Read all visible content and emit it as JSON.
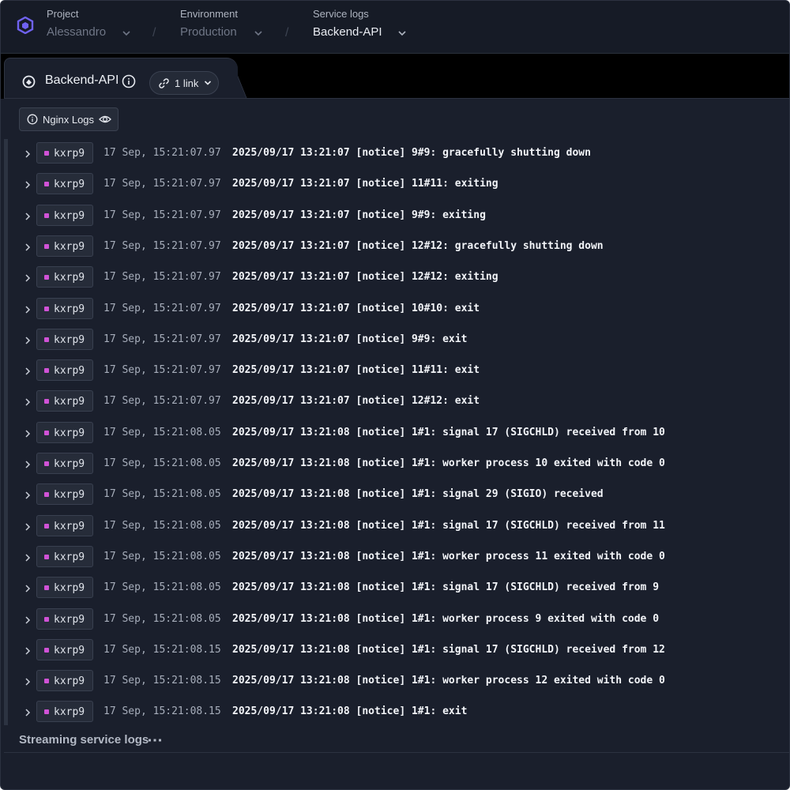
{
  "nav": {
    "crumbs": [
      {
        "label": "Project",
        "value": "Alessandro"
      },
      {
        "label": "Environment",
        "value": "Production"
      },
      {
        "label": "Service logs",
        "value": "Backend-API"
      }
    ],
    "separator": "/"
  },
  "tab": {
    "service_name": "Backend-API",
    "link_label": "1 link"
  },
  "panel": {
    "source_label": "Nginx Logs",
    "status_text": "Streaming service logs"
  },
  "colors": {
    "pod_dot": "#d052d6",
    "accent": "#6f62f0"
  },
  "logs": [
    {
      "pod": "kxrp9",
      "time": "17 Sep, 15:21:07.97",
      "message": "2025/09/17 13:21:07 [notice] 9#9: gracefully shutting down"
    },
    {
      "pod": "kxrp9",
      "time": "17 Sep, 15:21:07.97",
      "message": "2025/09/17 13:21:07 [notice] 11#11: exiting"
    },
    {
      "pod": "kxrp9",
      "time": "17 Sep, 15:21:07.97",
      "message": "2025/09/17 13:21:07 [notice] 9#9: exiting"
    },
    {
      "pod": "kxrp9",
      "time": "17 Sep, 15:21:07.97",
      "message": "2025/09/17 13:21:07 [notice] 12#12: gracefully shutting down"
    },
    {
      "pod": "kxrp9",
      "time": "17 Sep, 15:21:07.97",
      "message": "2025/09/17 13:21:07 [notice] 12#12: exiting"
    },
    {
      "pod": "kxrp9",
      "time": "17 Sep, 15:21:07.97",
      "message": "2025/09/17 13:21:07 [notice] 10#10: exit"
    },
    {
      "pod": "kxrp9",
      "time": "17 Sep, 15:21:07.97",
      "message": "2025/09/17 13:21:07 [notice] 9#9: exit"
    },
    {
      "pod": "kxrp9",
      "time": "17 Sep, 15:21:07.97",
      "message": "2025/09/17 13:21:07 [notice] 11#11: exit"
    },
    {
      "pod": "kxrp9",
      "time": "17 Sep, 15:21:07.97",
      "message": "2025/09/17 13:21:07 [notice] 12#12: exit"
    },
    {
      "pod": "kxrp9",
      "time": "17 Sep, 15:21:08.05",
      "message": "2025/09/17 13:21:08 [notice] 1#1: signal 17 (SIGCHLD) received from 10"
    },
    {
      "pod": "kxrp9",
      "time": "17 Sep, 15:21:08.05",
      "message": "2025/09/17 13:21:08 [notice] 1#1: worker process 10 exited with code 0"
    },
    {
      "pod": "kxrp9",
      "time": "17 Sep, 15:21:08.05",
      "message": "2025/09/17 13:21:08 [notice] 1#1: signal 29 (SIGIO) received"
    },
    {
      "pod": "kxrp9",
      "time": "17 Sep, 15:21:08.05",
      "message": "2025/09/17 13:21:08 [notice] 1#1: signal 17 (SIGCHLD) received from 11"
    },
    {
      "pod": "kxrp9",
      "time": "17 Sep, 15:21:08.05",
      "message": "2025/09/17 13:21:08 [notice] 1#1: worker process 11 exited with code 0"
    },
    {
      "pod": "kxrp9",
      "time": "17 Sep, 15:21:08.05",
      "message": "2025/09/17 13:21:08 [notice] 1#1: signal 17 (SIGCHLD) received from 9"
    },
    {
      "pod": "kxrp9",
      "time": "17 Sep, 15:21:08.05",
      "message": "2025/09/17 13:21:08 [notice] 1#1: worker process 9 exited with code 0"
    },
    {
      "pod": "kxrp9",
      "time": "17 Sep, 15:21:08.15",
      "message": "2025/09/17 13:21:08 [notice] 1#1: signal 17 (SIGCHLD) received from 12"
    },
    {
      "pod": "kxrp9",
      "time": "17 Sep, 15:21:08.15",
      "message": "2025/09/17 13:21:08 [notice] 1#1: worker process 12 exited with code 0"
    },
    {
      "pod": "kxrp9",
      "time": "17 Sep, 15:21:08.15",
      "message": "2025/09/17 13:21:08 [notice] 1#1: exit"
    }
  ]
}
